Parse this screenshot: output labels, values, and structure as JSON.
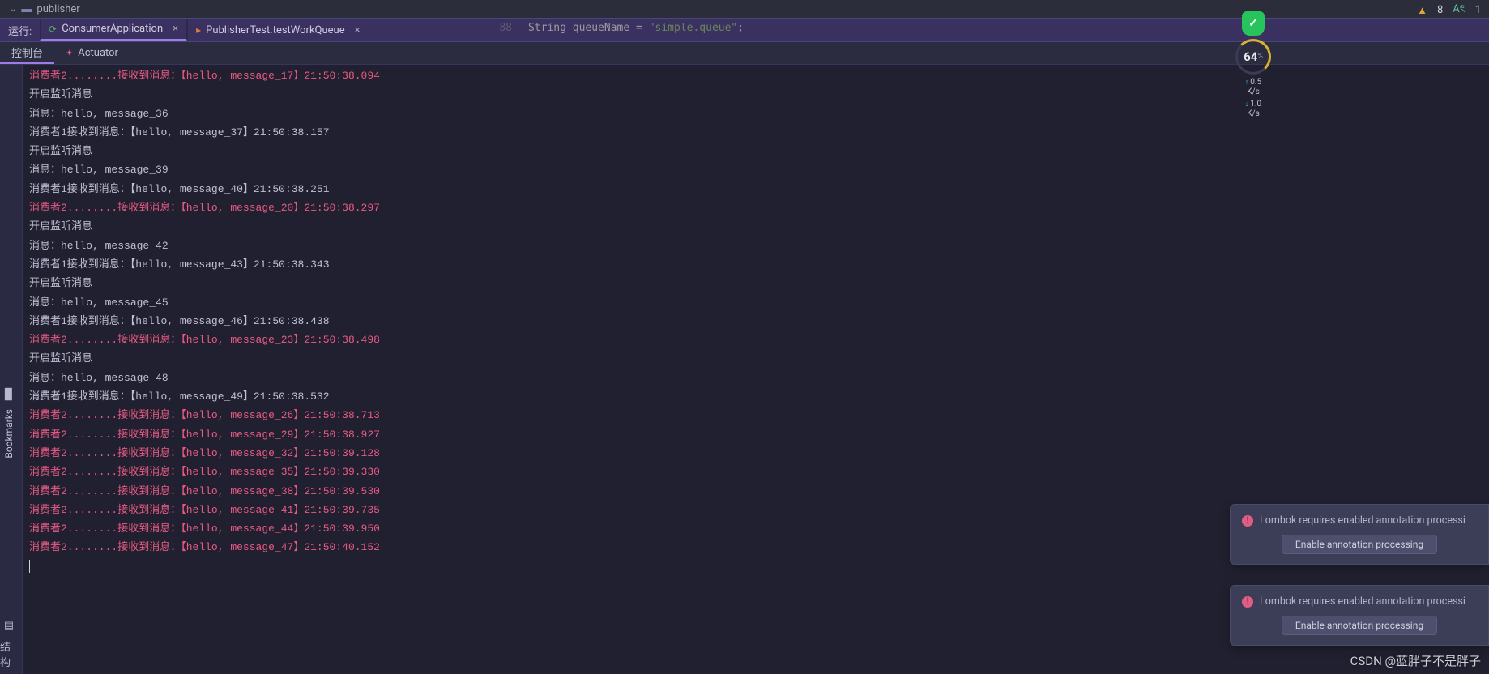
{
  "editor": {
    "file_tab": "publisher",
    "line_number": "88",
    "code_prefix": "String queueName = ",
    "code_string": "\"simple.queue\"",
    "code_suffix": ";"
  },
  "top_status": {
    "warnings": "8",
    "typos": "1"
  },
  "run_bar": {
    "label": "运行:",
    "tabs": [
      {
        "label": "ConsumerApplication",
        "icon": "run",
        "active": true
      },
      {
        "label": "PublisherTest.testWorkQueue",
        "icon": "test",
        "active": false
      }
    ]
  },
  "sub_bar": {
    "tabs": [
      {
        "label": "控制台",
        "active": true,
        "icon": ""
      },
      {
        "label": "Actuator",
        "active": false,
        "icon": "actuator"
      }
    ]
  },
  "left_rail": {
    "bookmarks": "Bookmarks",
    "structure": "结构"
  },
  "meter": {
    "percent": "64",
    "up_rate": "0.5",
    "up_unit": "K/s",
    "down_rate": "1.0",
    "down_unit": "K/s"
  },
  "notifications": [
    {
      "title": "Lombok requires enabled annotation processi",
      "button": "Enable annotation processing"
    },
    {
      "title": "Lombok requires enabled annotation processi",
      "button": "Enable annotation processing"
    }
  ],
  "watermark": "CSDN @蓝胖子不是胖子",
  "console_lines": [
    {
      "type": "err",
      "text": "消费者2........接收到消息：【hello, message_17】21:50:38.094"
    },
    {
      "type": "norm",
      "text": "开启监听消息"
    },
    {
      "type": "norm",
      "text": "消息：hello, message_36"
    },
    {
      "type": "norm",
      "text": "消费者1接收到消息：【hello, message_37】21:50:38.157"
    },
    {
      "type": "norm",
      "text": "开启监听消息"
    },
    {
      "type": "norm",
      "text": "消息：hello, message_39"
    },
    {
      "type": "norm",
      "text": "消费者1接收到消息：【hello, message_40】21:50:38.251"
    },
    {
      "type": "err",
      "text": "消费者2........接收到消息：【hello, message_20】21:50:38.297"
    },
    {
      "type": "norm",
      "text": "开启监听消息"
    },
    {
      "type": "norm",
      "text": "消息：hello, message_42"
    },
    {
      "type": "norm",
      "text": "消费者1接收到消息：【hello, message_43】21:50:38.343"
    },
    {
      "type": "norm",
      "text": "开启监听消息"
    },
    {
      "type": "norm",
      "text": "消息：hello, message_45"
    },
    {
      "type": "norm",
      "text": "消费者1接收到消息：【hello, message_46】21:50:38.438"
    },
    {
      "type": "err",
      "text": "消费者2........接收到消息：【hello, message_23】21:50:38.498"
    },
    {
      "type": "norm",
      "text": "开启监听消息"
    },
    {
      "type": "norm",
      "text": "消息：hello, message_48"
    },
    {
      "type": "norm",
      "text": "消费者1接收到消息：【hello, message_49】21:50:38.532"
    },
    {
      "type": "err",
      "text": "消费者2........接收到消息：【hello, message_26】21:50:38.713"
    },
    {
      "type": "err",
      "text": "消费者2........接收到消息：【hello, message_29】21:50:38.927"
    },
    {
      "type": "err",
      "text": "消费者2........接收到消息：【hello, message_32】21:50:39.128"
    },
    {
      "type": "err",
      "text": "消费者2........接收到消息：【hello, message_35】21:50:39.330"
    },
    {
      "type": "err",
      "text": "消费者2........接收到消息：【hello, message_38】21:50:39.530"
    },
    {
      "type": "err",
      "text": "消费者2........接收到消息：【hello, message_41】21:50:39.735"
    },
    {
      "type": "err",
      "text": "消费者2........接收到消息：【hello, message_44】21:50:39.950"
    },
    {
      "type": "err",
      "text": "消费者2........接收到消息：【hello, message_47】21:50:40.152"
    }
  ]
}
